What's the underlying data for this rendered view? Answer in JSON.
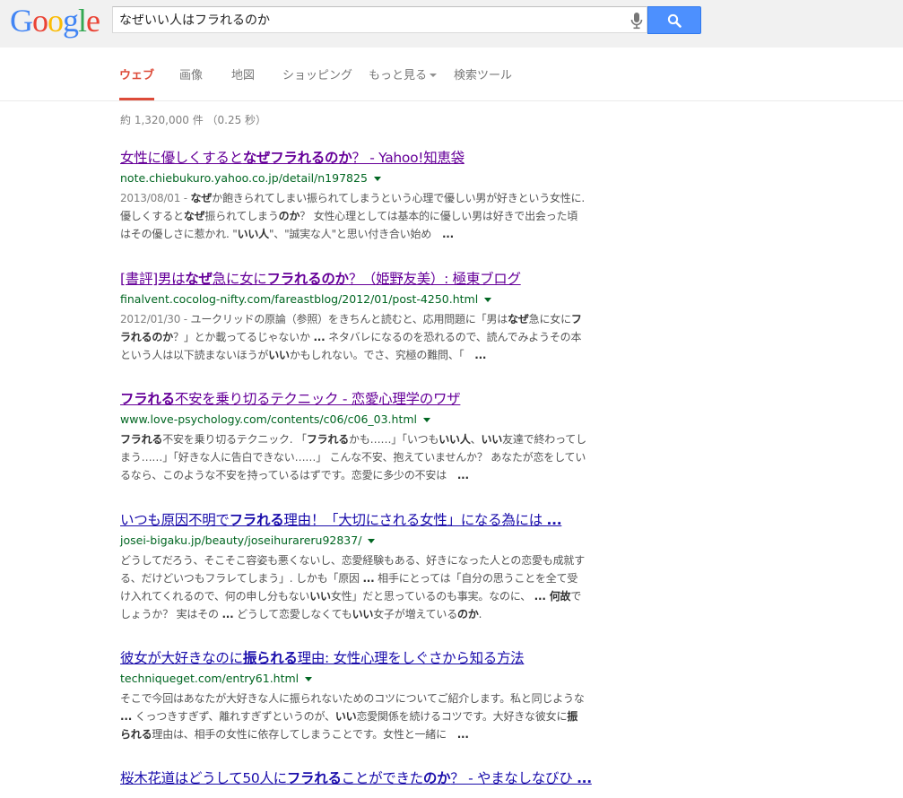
{
  "logo": [
    "G",
    "o",
    "o",
    "g",
    "l",
    "e"
  ],
  "search": {
    "query": "なぜいい人はフラれるのか"
  },
  "tabs": [
    "ウェブ",
    "画像",
    "地図",
    "ショッピング",
    "もっと見る",
    "検索ツール"
  ],
  "stats": "約 1,320,000 件 （0.25 秒）",
  "colors": {
    "link": "#1a0dab",
    "visited": "#660099",
    "url": "#006621",
    "accent": "#dd4b39",
    "button": "#4d90fe"
  },
  "icons": {
    "mic": "microphone-icon",
    "search": "magnifier-icon"
  },
  "results": [
    {
      "title": [
        {
          "t": "女性に優しくすると"
        },
        {
          "t": "なぜフラれるのか",
          "b": true
        },
        {
          "t": "？ - Yahoo!知恵袋"
        }
      ],
      "visited": true,
      "url": "note.chiebukuro.yahoo.co.jp/detail/n197825",
      "date": "2013/08/01 - ",
      "snippet": [
        {
          "t": "なぜ",
          "b": true
        },
        {
          "t": "か飽きられてしまい振られてしまうという心理で優しい男が好きという女性に. 優しくすると"
        },
        {
          "t": "なぜ",
          "b": true
        },
        {
          "t": "振られてしまう"
        },
        {
          "t": "のか",
          "b": true
        },
        {
          "t": "？ 女性心理としては基本的に優しい男は好きで出会った頃はその優しさに惹かれ. \""
        },
        {
          "t": "いい人",
          "b": true
        },
        {
          "t": "\"、\"誠実な人\"と思い付き合い始め　"
        },
        {
          "t": "...",
          "b": true
        }
      ]
    },
    {
      "title": [
        {
          "t": "[書評]男は"
        },
        {
          "t": "なぜ",
          "b": true
        },
        {
          "t": "急に女に"
        },
        {
          "t": "フラれるのか",
          "b": true
        },
        {
          "t": "？（姫野友美）: 極東ブログ"
        }
      ],
      "visited": true,
      "url": "finalvent.cocolog-nifty.com/fareastblog/2012/01/post-4250.html",
      "date": "2012/01/30 - ",
      "snippet": [
        {
          "t": "ユークリッドの原論（参照）をきちんと読むと、応用問題に「男は"
        },
        {
          "t": "なぜ",
          "b": true
        },
        {
          "t": "急に女に"
        },
        {
          "t": "フラれるのか",
          "b": true
        },
        {
          "t": "？」とか載ってるじゃないか "
        },
        {
          "t": "...",
          "b": true
        },
        {
          "t": " ネタバレになるのを恐れるので、読んでみようその本という人は以下読まないほうが"
        },
        {
          "t": "いい",
          "b": true
        },
        {
          "t": "かもしれない。でさ、究極の難問、「　"
        },
        {
          "t": "...",
          "b": true
        }
      ]
    },
    {
      "title": [
        {
          "t": "フラれる",
          "b": true
        },
        {
          "t": "不安を乗り切るテクニック - 恋愛心理学のワザ"
        }
      ],
      "visited": true,
      "url": "www.love-psychology.com/contents/c06/c06_03.html",
      "date": "",
      "snippet": [
        {
          "t": "フラれる",
          "b": true
        },
        {
          "t": "不安を乗り切るテクニック. 「"
        },
        {
          "t": "フラれる",
          "b": true
        },
        {
          "t": "かも……」「いつも"
        },
        {
          "t": "いい人",
          "b": true
        },
        {
          "t": "、"
        },
        {
          "t": "いい",
          "b": true
        },
        {
          "t": "友達で終わってしまう……」「好きな人に告白できない……」 こんな不安、抱えていませんか？ あなたが恋をしているなら、このような不安を持っているはずです。恋愛に多少の不安は　"
        },
        {
          "t": "...",
          "b": true
        }
      ]
    },
    {
      "title": [
        {
          "t": "いつも原因不明で"
        },
        {
          "t": "フラれる",
          "b": true
        },
        {
          "t": "理由！「大切にされる女性」になる為には "
        },
        {
          "t": "...",
          "b": true
        }
      ],
      "visited": false,
      "url": "josei-bigaku.jp/beauty/joseihurareru92837/",
      "date": "",
      "snippet": [
        {
          "t": "どうしてだろう、そこそこ容姿も悪くないし、恋愛経験もある、好きになった人との恋愛も成就する、だけどいつもフラレてしまう」. しかも「原因 "
        },
        {
          "t": "...",
          "b": true
        },
        {
          "t": " 相手にとっては「自分の思うことを全て受け入れてくれるので、何の申し分もない"
        },
        {
          "t": "いい",
          "b": true
        },
        {
          "t": "女性」だと思っているのも事実。なのに、 "
        },
        {
          "t": "... 何故",
          "b": true
        },
        {
          "t": "でしょうか？ 実はその "
        },
        {
          "t": "...",
          "b": true
        },
        {
          "t": " どうして恋愛しなくても"
        },
        {
          "t": "いい",
          "b": true
        },
        {
          "t": "女子が増えている"
        },
        {
          "t": "のか",
          "b": true
        },
        {
          "t": "."
        }
      ]
    },
    {
      "title": [
        {
          "t": "彼女が大好きなのに"
        },
        {
          "t": "振られる",
          "b": true
        },
        {
          "t": "理由: 女性心理をしぐさから知る方法"
        }
      ],
      "visited": false,
      "url": "techniqueget.com/entry61.html",
      "date": "",
      "snippet": [
        {
          "t": "そこで今回はあなたが大好きな人に振られないためのコツについてご紹介します。私と同じような "
        },
        {
          "t": "...",
          "b": true
        },
        {
          "t": " くっつきすぎず、離れすぎずというのが、"
        },
        {
          "t": "いい",
          "b": true
        },
        {
          "t": "恋愛関係を続けるコツです。大好きな彼女に"
        },
        {
          "t": "振られる",
          "b": true
        },
        {
          "t": "理由は、相手の女性に依存してしまうことです。女性と一緒に　"
        },
        {
          "t": "...",
          "b": true
        }
      ]
    },
    {
      "title": [
        {
          "t": "桜木花道はどうして50人に"
        },
        {
          "t": "フラれる",
          "b": true
        },
        {
          "t": "ことができた"
        },
        {
          "t": "のか",
          "b": true
        },
        {
          "t": "？ - やまなしなびひ "
        },
        {
          "t": "...",
          "b": true
        }
      ],
      "visited": false,
      "url": "",
      "date": "",
      "snippet": []
    }
  ]
}
